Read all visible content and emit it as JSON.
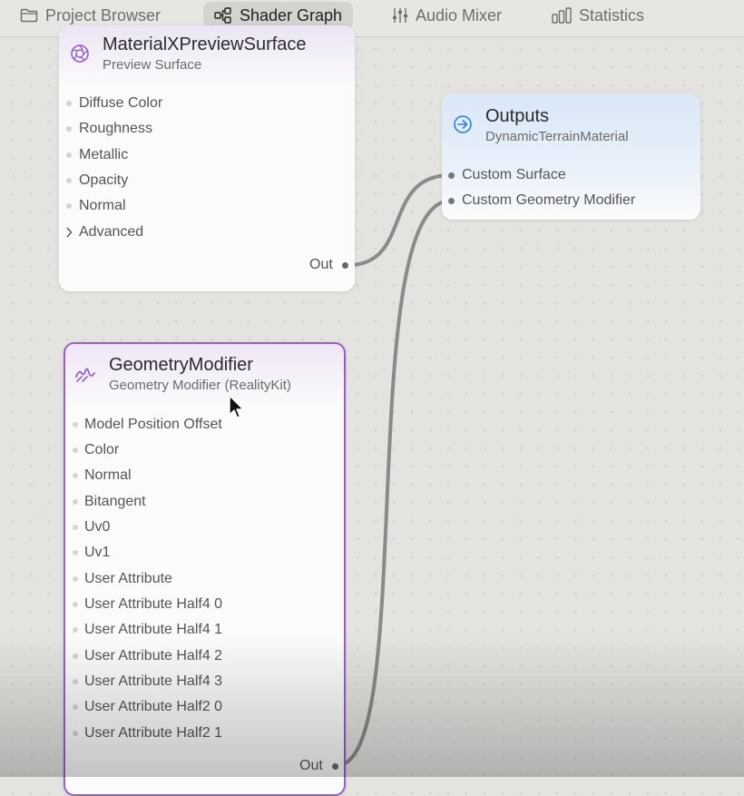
{
  "tabs": [
    {
      "label": "Project Browser",
      "icon": "folder-icon",
      "active": false
    },
    {
      "label": "Shader Graph",
      "icon": "shader-graph-icon",
      "active": true
    },
    {
      "label": "Audio Mixer",
      "icon": "sliders-icon",
      "active": false
    },
    {
      "label": "Statistics",
      "icon": "bar-chart-icon",
      "active": false
    }
  ],
  "nodes": {
    "preview_surface": {
      "title": "MaterialXPreviewSurface",
      "subtitle": "Preview Surface",
      "icon": "aperture-icon",
      "inputs": [
        "Diffuse Color",
        "Roughness",
        "Metallic",
        "Opacity",
        "Normal"
      ],
      "advanced_label": "Advanced",
      "output_label": "Out"
    },
    "outputs": {
      "title": "Outputs",
      "subtitle": "DynamicTerrainMaterial",
      "icon": "arrow-right-circle-icon",
      "inputs": [
        "Custom Surface",
        "Custom Geometry Modifier"
      ]
    },
    "geometry_modifier": {
      "title": "GeometryModifier",
      "subtitle": "Geometry Modifier (RealityKit)",
      "icon": "squiggle-icon",
      "inputs": [
        "Model Position Offset",
        "Color",
        "Normal",
        "Bitangent",
        "Uv0",
        "Uv1",
        "User Attribute",
        "User Attribute Half4 0",
        "User Attribute Half4 1",
        "User Attribute Half4 2",
        "User Attribute Half4 3",
        "User Attribute Half2 0",
        "User Attribute Half2 1"
      ],
      "output_label": "Out"
    }
  },
  "colors": {
    "accent_purple": "#9a5bd0",
    "outputs_blue": "#2f7fd6",
    "wire": "#8a8a8a"
  }
}
